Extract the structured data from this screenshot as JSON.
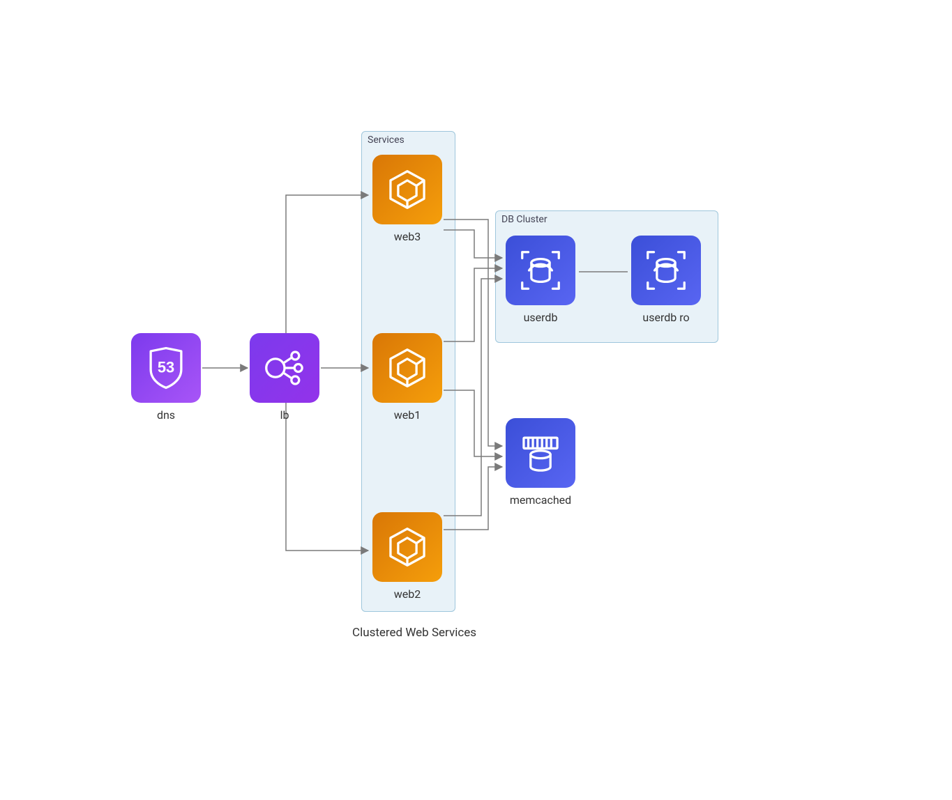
{
  "caption": "Clustered Web Services",
  "groups": {
    "services": {
      "title": "Services"
    },
    "dbcluster": {
      "title": "DB Cluster"
    }
  },
  "nodes": {
    "dns": {
      "label": "dns"
    },
    "lb": {
      "label": "lb"
    },
    "web3": {
      "label": "web3"
    },
    "web1": {
      "label": "web1"
    },
    "web2": {
      "label": "web2"
    },
    "userdb": {
      "label": "userdb"
    },
    "userdbro": {
      "label": "userdb ro"
    },
    "memcached": {
      "label": "memcached"
    }
  },
  "colors": {
    "route53": "#8b47f5",
    "elb": "#8b47f5",
    "ecs": "#ef8a17",
    "rds": "#4053d6",
    "elasticache": "#4053d6",
    "groupBorder": "#9ec6dc",
    "groupFill": "#e8f2f8",
    "arrow": "#7a7a7a"
  },
  "edges": [
    [
      "dns",
      "lb"
    ],
    [
      "lb",
      "web1"
    ],
    [
      "lb",
      "web3"
    ],
    [
      "lb",
      "web2"
    ],
    [
      "web3",
      "userdb"
    ],
    [
      "web1",
      "userdb"
    ],
    [
      "web2",
      "userdb"
    ],
    [
      "web3",
      "memcached"
    ],
    [
      "web1",
      "memcached"
    ],
    [
      "web2",
      "memcached"
    ],
    [
      "userdb",
      "userdbro"
    ]
  ]
}
